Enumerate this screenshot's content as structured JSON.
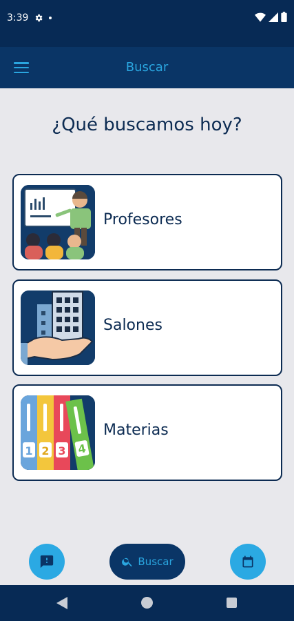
{
  "status_bar": {
    "time": "3:39"
  },
  "app_bar": {
    "title": "Buscar"
  },
  "heading": "¿Qué buscamos hoy?",
  "cards": [
    {
      "label": "Profesores"
    },
    {
      "label": "Salones"
    },
    {
      "label": "Materias"
    }
  ],
  "bottom_bar": {
    "search_label": "Buscar"
  },
  "colors": {
    "primary_dark": "#0a3566",
    "accent": "#2aa6e0",
    "background": "#e8e8ec",
    "text": "#0c2b52"
  }
}
